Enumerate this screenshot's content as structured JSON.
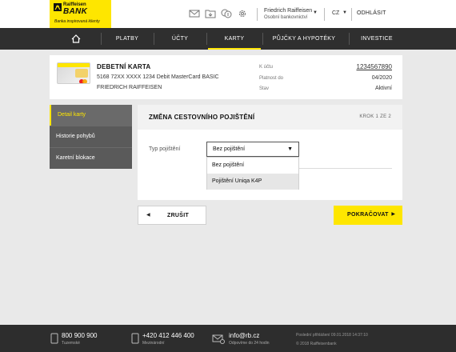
{
  "brand": {
    "name_top": "Raiffeisen",
    "name_main": "BANK",
    "tagline": "Banka inspirovaná klienty",
    "accent": "#fee600"
  },
  "header": {
    "icons": [
      "mail-icon",
      "folder-icon",
      "money-icon",
      "gear-icon"
    ],
    "user_name": "Friedrich Raiffeisen",
    "user_type": "Osobní bankovnictví",
    "language": "CZ",
    "logout": "ODHLÁSIT"
  },
  "nav": {
    "items": [
      "PLATBY",
      "ÚČTY",
      "KARTY",
      "PŮJČKY A HYPOTÉKY",
      "INVESTICE"
    ],
    "active": "KARTY"
  },
  "card": {
    "title": "DEBETNÍ KARTA",
    "number": "5168 72XX XXXX 1234 Debit MasterCard BASIC",
    "holder": "FRIEDRICH RAIFFEISEN",
    "account_label": "K účtu",
    "account_value": "1234567890",
    "valid_label": "Platnost do",
    "valid_value": "04/2020",
    "state_label": "Stav",
    "state_value": "Aktivní"
  },
  "sidebar": {
    "items": [
      "Detail karty",
      "Historie pohybů",
      "Karetní blokace"
    ],
    "active": "Detail karty"
  },
  "main": {
    "title": "ZMĚNA CESTOVNÍHO POJIŠTĚNÍ",
    "step": "KROK 1 ZE 2",
    "field_label": "Typ pojištění",
    "select_value": "Bez pojištění",
    "options": [
      "Bez pojištění",
      "Pojištění Uniqa K4P"
    ],
    "hovered_option": "Pojištění Uniqa K4P"
  },
  "buttons": {
    "back": "ZRUŠIT",
    "next": "POKRAČOVAT"
  },
  "footer": {
    "phone": "800 900 900",
    "phone_sub": "Tuzemské",
    "phone_intl": "+420 412 446 400",
    "phone_intl_sub": "Mezinárodní",
    "email": "info@rb.cz",
    "email_sub": "Odpovíme do 24 hodin",
    "last_login": "Poslední přihlášení 09.01.2018 14:37:10",
    "copyright": "© 2018 Raiffeisenbank"
  }
}
